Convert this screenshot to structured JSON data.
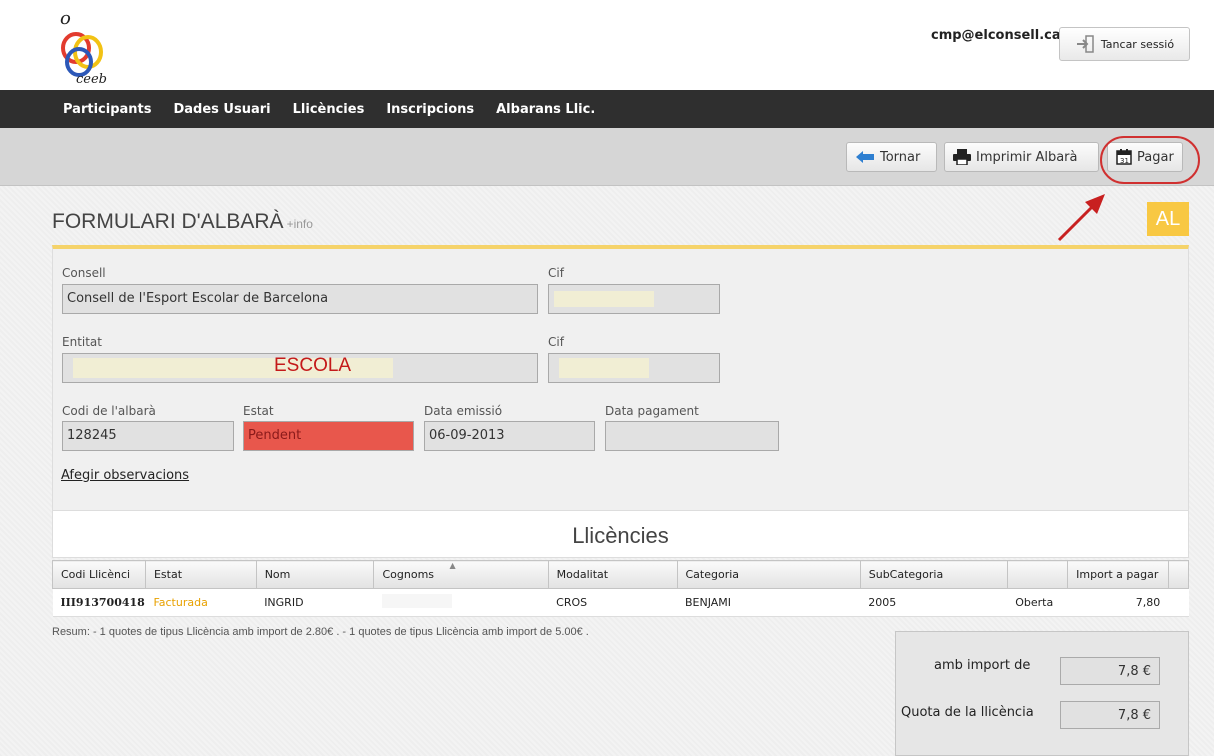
{
  "header": {
    "user_email": "cmp@elconsell.cat",
    "logout_label": "Tancar sessió",
    "logo_text": "ceeb"
  },
  "nav": {
    "items": [
      "Participants",
      "Dades Usuari",
      "Llicències",
      "Inscripcions",
      "Albarans Llic."
    ]
  },
  "toolbar": {
    "back_label": "Tornar",
    "print_label": "Imprimir Albarà",
    "pay_label": "Pagar"
  },
  "page": {
    "title": "FORMULARI D'ALBARÀ",
    "info_link": "+info",
    "badge": "AL"
  },
  "form": {
    "consell_label": "Consell",
    "consell_value": "Consell de l'Esport Escolar de Barcelona",
    "cif_label": "Cif",
    "entitat_label": "Entitat",
    "entitat_value": "ESCOLA",
    "codi_label": "Codi de l'albarà",
    "codi_value": "128245",
    "estat_label": "Estat",
    "estat_value": "Pendent",
    "data_emissio_label": "Data emissió",
    "data_emissio_value": "06-09-2013",
    "data_pagament_label": "Data pagament",
    "data_pagament_value": "",
    "observacions_link": "Afegir observacions"
  },
  "licences": {
    "title": "Llicències",
    "columns": [
      "Codi Llicènci",
      "Estat",
      "Nom",
      "Cognoms",
      "Modalitat",
      "Categoria",
      "SubCategoria",
      "",
      "Import a pagar"
    ],
    "rows": [
      {
        "codi": "III913700418",
        "estat": "Facturada",
        "nom": "INGRID",
        "cognoms": "",
        "modalitat": "CROS",
        "categoria": "BENJAMI",
        "subcategoria": "2005",
        "tipus": "Oberta",
        "import": "7,80"
      }
    ],
    "summary": "Resum: - 1 quotes de tipus Llicència amb import de 2.80€ . - 1 quotes de tipus Llicència amb import de 5.00€ ."
  },
  "totals": {
    "amb_import_label": "amb import de",
    "amb_import_value": "7,8 €",
    "quota_label": "Quota de la llicència",
    "quota_value": "7,8 €"
  },
  "colors": {
    "nav_bg": "#2f2f2f",
    "accent_yellow": "#f8c843",
    "status_pending": "#e8574c",
    "estat_facturada": "#e8a100",
    "highlight_red": "#d03030"
  }
}
